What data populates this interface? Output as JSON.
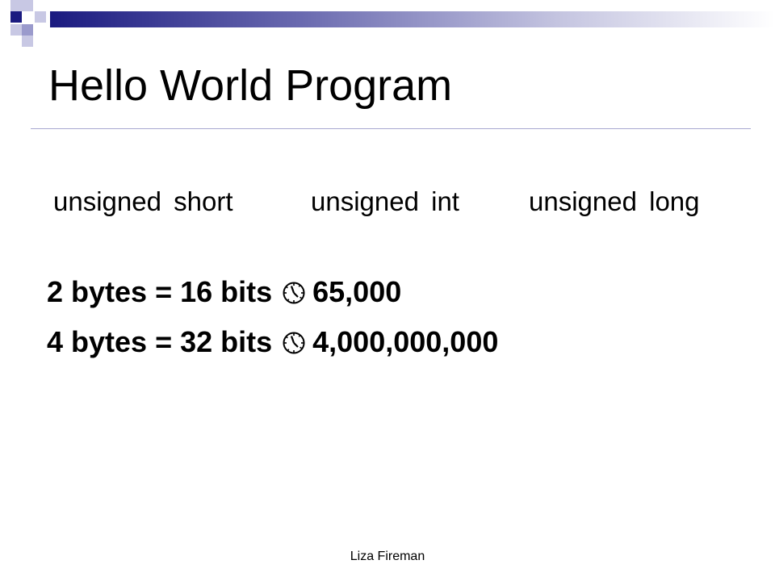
{
  "slide": {
    "title": "Hello World Program",
    "type_labels": [
      "unsigned short",
      "unsigned int",
      "unsigned long"
    ],
    "size_lines": [
      {
        "left": "2 bytes = 16 bits",
        "icon": "clock-icon",
        "right": "65,000"
      },
      {
        "left": "4 bytes = 32 bits",
        "icon": "clock-icon",
        "right": "4,000,000,000"
      }
    ],
    "footer": "Liza Fireman"
  },
  "colors": {
    "accent_dark": "#1a1a80",
    "accent_light": "#c4c4e0",
    "rule": "#a8a8d0",
    "text": "#000000"
  }
}
